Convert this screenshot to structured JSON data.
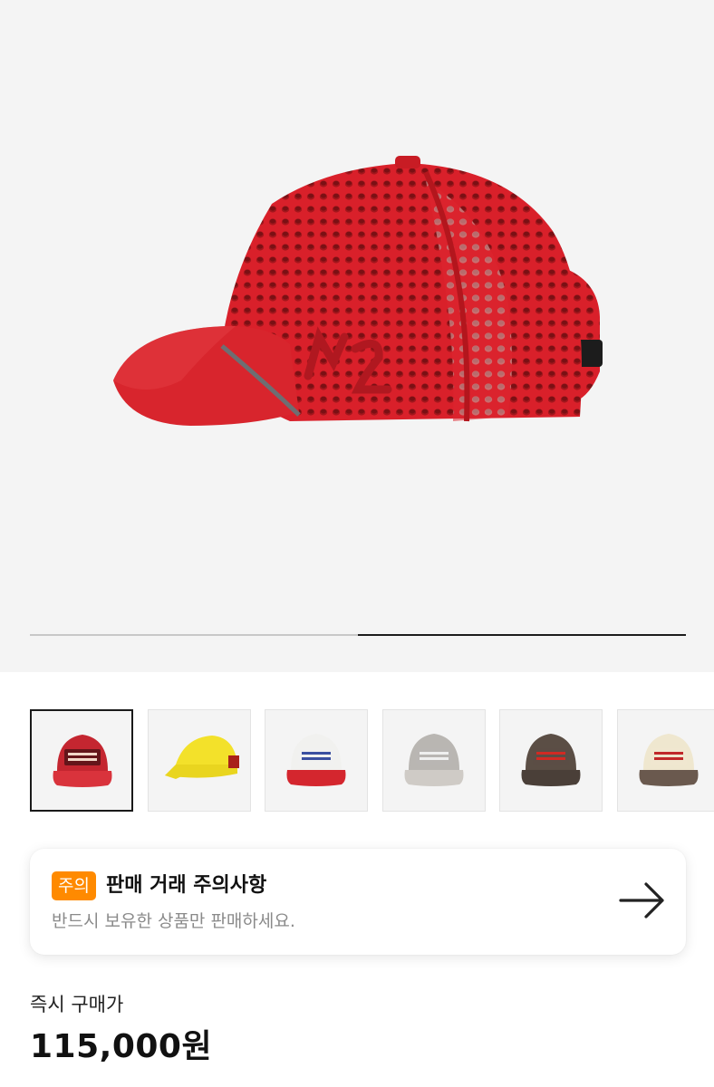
{
  "gallery": {
    "main_image_icon": "red-mesh-trucker-cap",
    "progress": {
      "segment_start": 0.5,
      "segment_end": 1.0
    },
    "thumbnails": [
      {
        "icon": "red-cap-i-dig-running",
        "selected": true,
        "crown": "#c42630",
        "brim": "#d9333c",
        "patch": "#5a1418",
        "patch_text": "#f2d7c8"
      },
      {
        "icon": "yellow-running-cap",
        "selected": false,
        "crown": "#f3e12a",
        "brim": "#e9d51f",
        "patch": "#a8211a",
        "patch_text": "#f3e12a"
      },
      {
        "icon": "white-red-i-dig-running-cap",
        "selected": false,
        "crown": "#f1f1ef",
        "brim": "#d4262e",
        "patch": "#f1f1ef",
        "patch_text": "#3a4fa0"
      },
      {
        "icon": "grey-embroidered-cap",
        "selected": false,
        "crown": "#b9b6b2",
        "brim": "#cfcbc6",
        "patch": "#b9b6b2",
        "patch_text": "#efefef"
      },
      {
        "icon": "brown-embroidered-cap",
        "selected": false,
        "crown": "#5b4e45",
        "brim": "#4a3f38",
        "patch": "#5b4e45",
        "patch_text": "#d12a23"
      },
      {
        "icon": "cream-brown-i-dig-running-cap",
        "selected": false,
        "crown": "#efe7cf",
        "brim": "#6a594e",
        "patch": "#efe7cf",
        "patch_text": "#c0282a"
      }
    ]
  },
  "notice": {
    "badge": "주의",
    "title": "판매 거래 주의사항",
    "description": "반드시 보유한 상품만 판매하세요.",
    "arrow_icon": "arrow-right-icon"
  },
  "price": {
    "label": "즉시 구매가",
    "value": "115,000원"
  },
  "colors": {
    "accent_orange": "#ff8a00",
    "hero_background": "#f4f4f4"
  }
}
